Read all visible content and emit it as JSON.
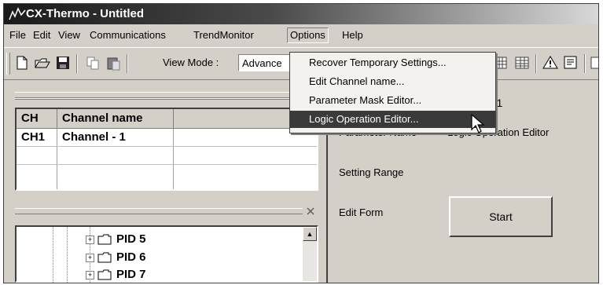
{
  "window": {
    "title": "CX-Thermo - Untitled"
  },
  "menu": [
    "File",
    "Edit",
    "View",
    "Communications",
    "TrendMonitor",
    "Options",
    "Help"
  ],
  "toolbar": {
    "view_mode_label": "View Mode :",
    "view_mode_value": "Advance"
  },
  "channel_table": {
    "headers": [
      "CH",
      "Channel name"
    ],
    "rows": [
      [
        "CH1",
        "Channel - 1"
      ]
    ]
  },
  "tree": {
    "items": [
      "PID 5",
      "PID 6",
      "PID 7"
    ]
  },
  "right_panel": {
    "channel_suffix": "- 1",
    "parameter_name_label": "Parameter Name",
    "parameter_name_value": "Logic Operation Editor",
    "setting_range_label": "Setting Range",
    "edit_form_label": "Edit Form",
    "start_label": "Start"
  },
  "options_menu": {
    "items": [
      "Recover Temporary Settings...",
      "Edit Channel name...",
      "Parameter Mask Editor...",
      "Logic Operation Editor..."
    ],
    "selected": "Logic Operation Editor..."
  }
}
